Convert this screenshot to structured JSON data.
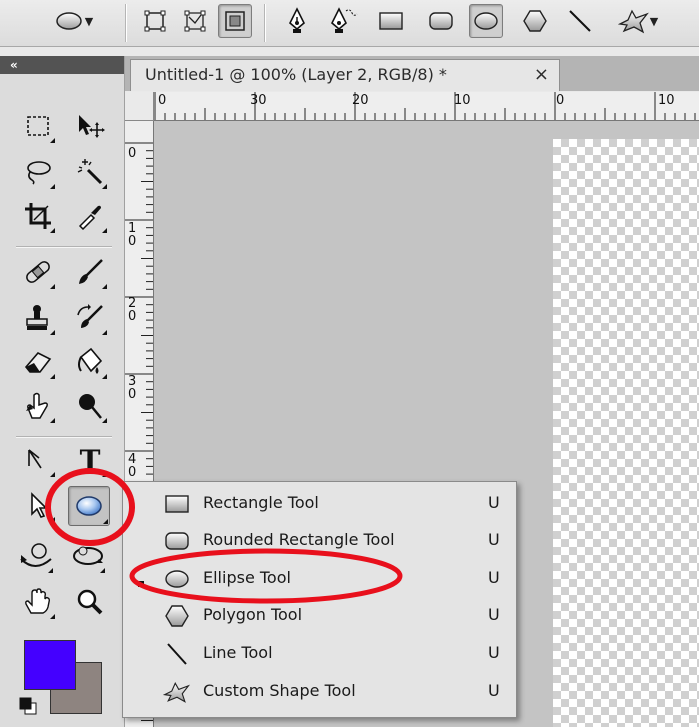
{
  "options_bar": {
    "tool_preset": "ellipse-preset-icon",
    "mode_buttons": [
      "shape-layers-icon",
      "paths-icon",
      "fill-pixels-icon"
    ],
    "selected_mode": 2,
    "shape_buttons": [
      "pen-icon",
      "freeform-pen-icon",
      "rectangle-icon",
      "rounded-rectangle-icon",
      "ellipse-icon",
      "polygon-icon",
      "line-icon",
      "custom-shape-icon"
    ],
    "selected_shape": 4
  },
  "tools_panel": {
    "collapse_label": "«",
    "type_tool_label": "T",
    "foreground_color": "#4400ff",
    "background_color": "#8e8480"
  },
  "document": {
    "tab_title": "Untitled-1 @ 100% (Layer 2, RGB/8) *",
    "close_label": "×",
    "ruler_top_labels": [
      "0",
      "30",
      "20",
      "10",
      "0",
      "10"
    ],
    "ruler_left_labels": [
      "0",
      "10",
      "20",
      "30",
      "40"
    ]
  },
  "flyout": {
    "items": [
      {
        "label": "Rectangle Tool",
        "shortcut": "U",
        "icon": "rectangle-icon"
      },
      {
        "label": "Rounded Rectangle Tool",
        "shortcut": "U",
        "icon": "rounded-rectangle-icon"
      },
      {
        "label": "Ellipse Tool",
        "shortcut": "U",
        "icon": "ellipse-icon"
      },
      {
        "label": "Polygon Tool",
        "shortcut": "U",
        "icon": "polygon-icon"
      },
      {
        "label": "Line Tool",
        "shortcut": "U",
        "icon": "line-icon"
      },
      {
        "label": "Custom Shape Tool",
        "shortcut": "U",
        "icon": "custom-shape-icon"
      }
    ],
    "active_index": 2
  },
  "annotation_color": "#e8101c"
}
